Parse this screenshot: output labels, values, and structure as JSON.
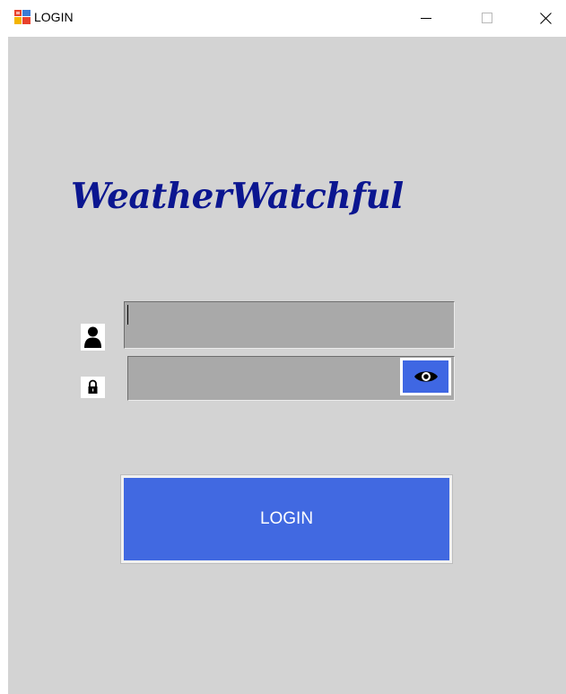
{
  "window": {
    "title": "LOGIN"
  },
  "app": {
    "brand": "WeatherWatchful"
  },
  "form": {
    "username_value": "",
    "password_value": "",
    "login_label": "LOGIN"
  },
  "icons": {
    "app": "app-icon",
    "minimize": "minimize-icon",
    "maximize": "maximize-icon",
    "close": "close-icon",
    "user": "user-icon",
    "lock": "lock-icon",
    "eye": "eye-icon"
  },
  "colors": {
    "client_background": "#d3d3d3",
    "brand_text": "#0b1690",
    "field_background": "#a9a9a9",
    "button_blue": "#4169e1",
    "button_text": "#ffffff"
  }
}
